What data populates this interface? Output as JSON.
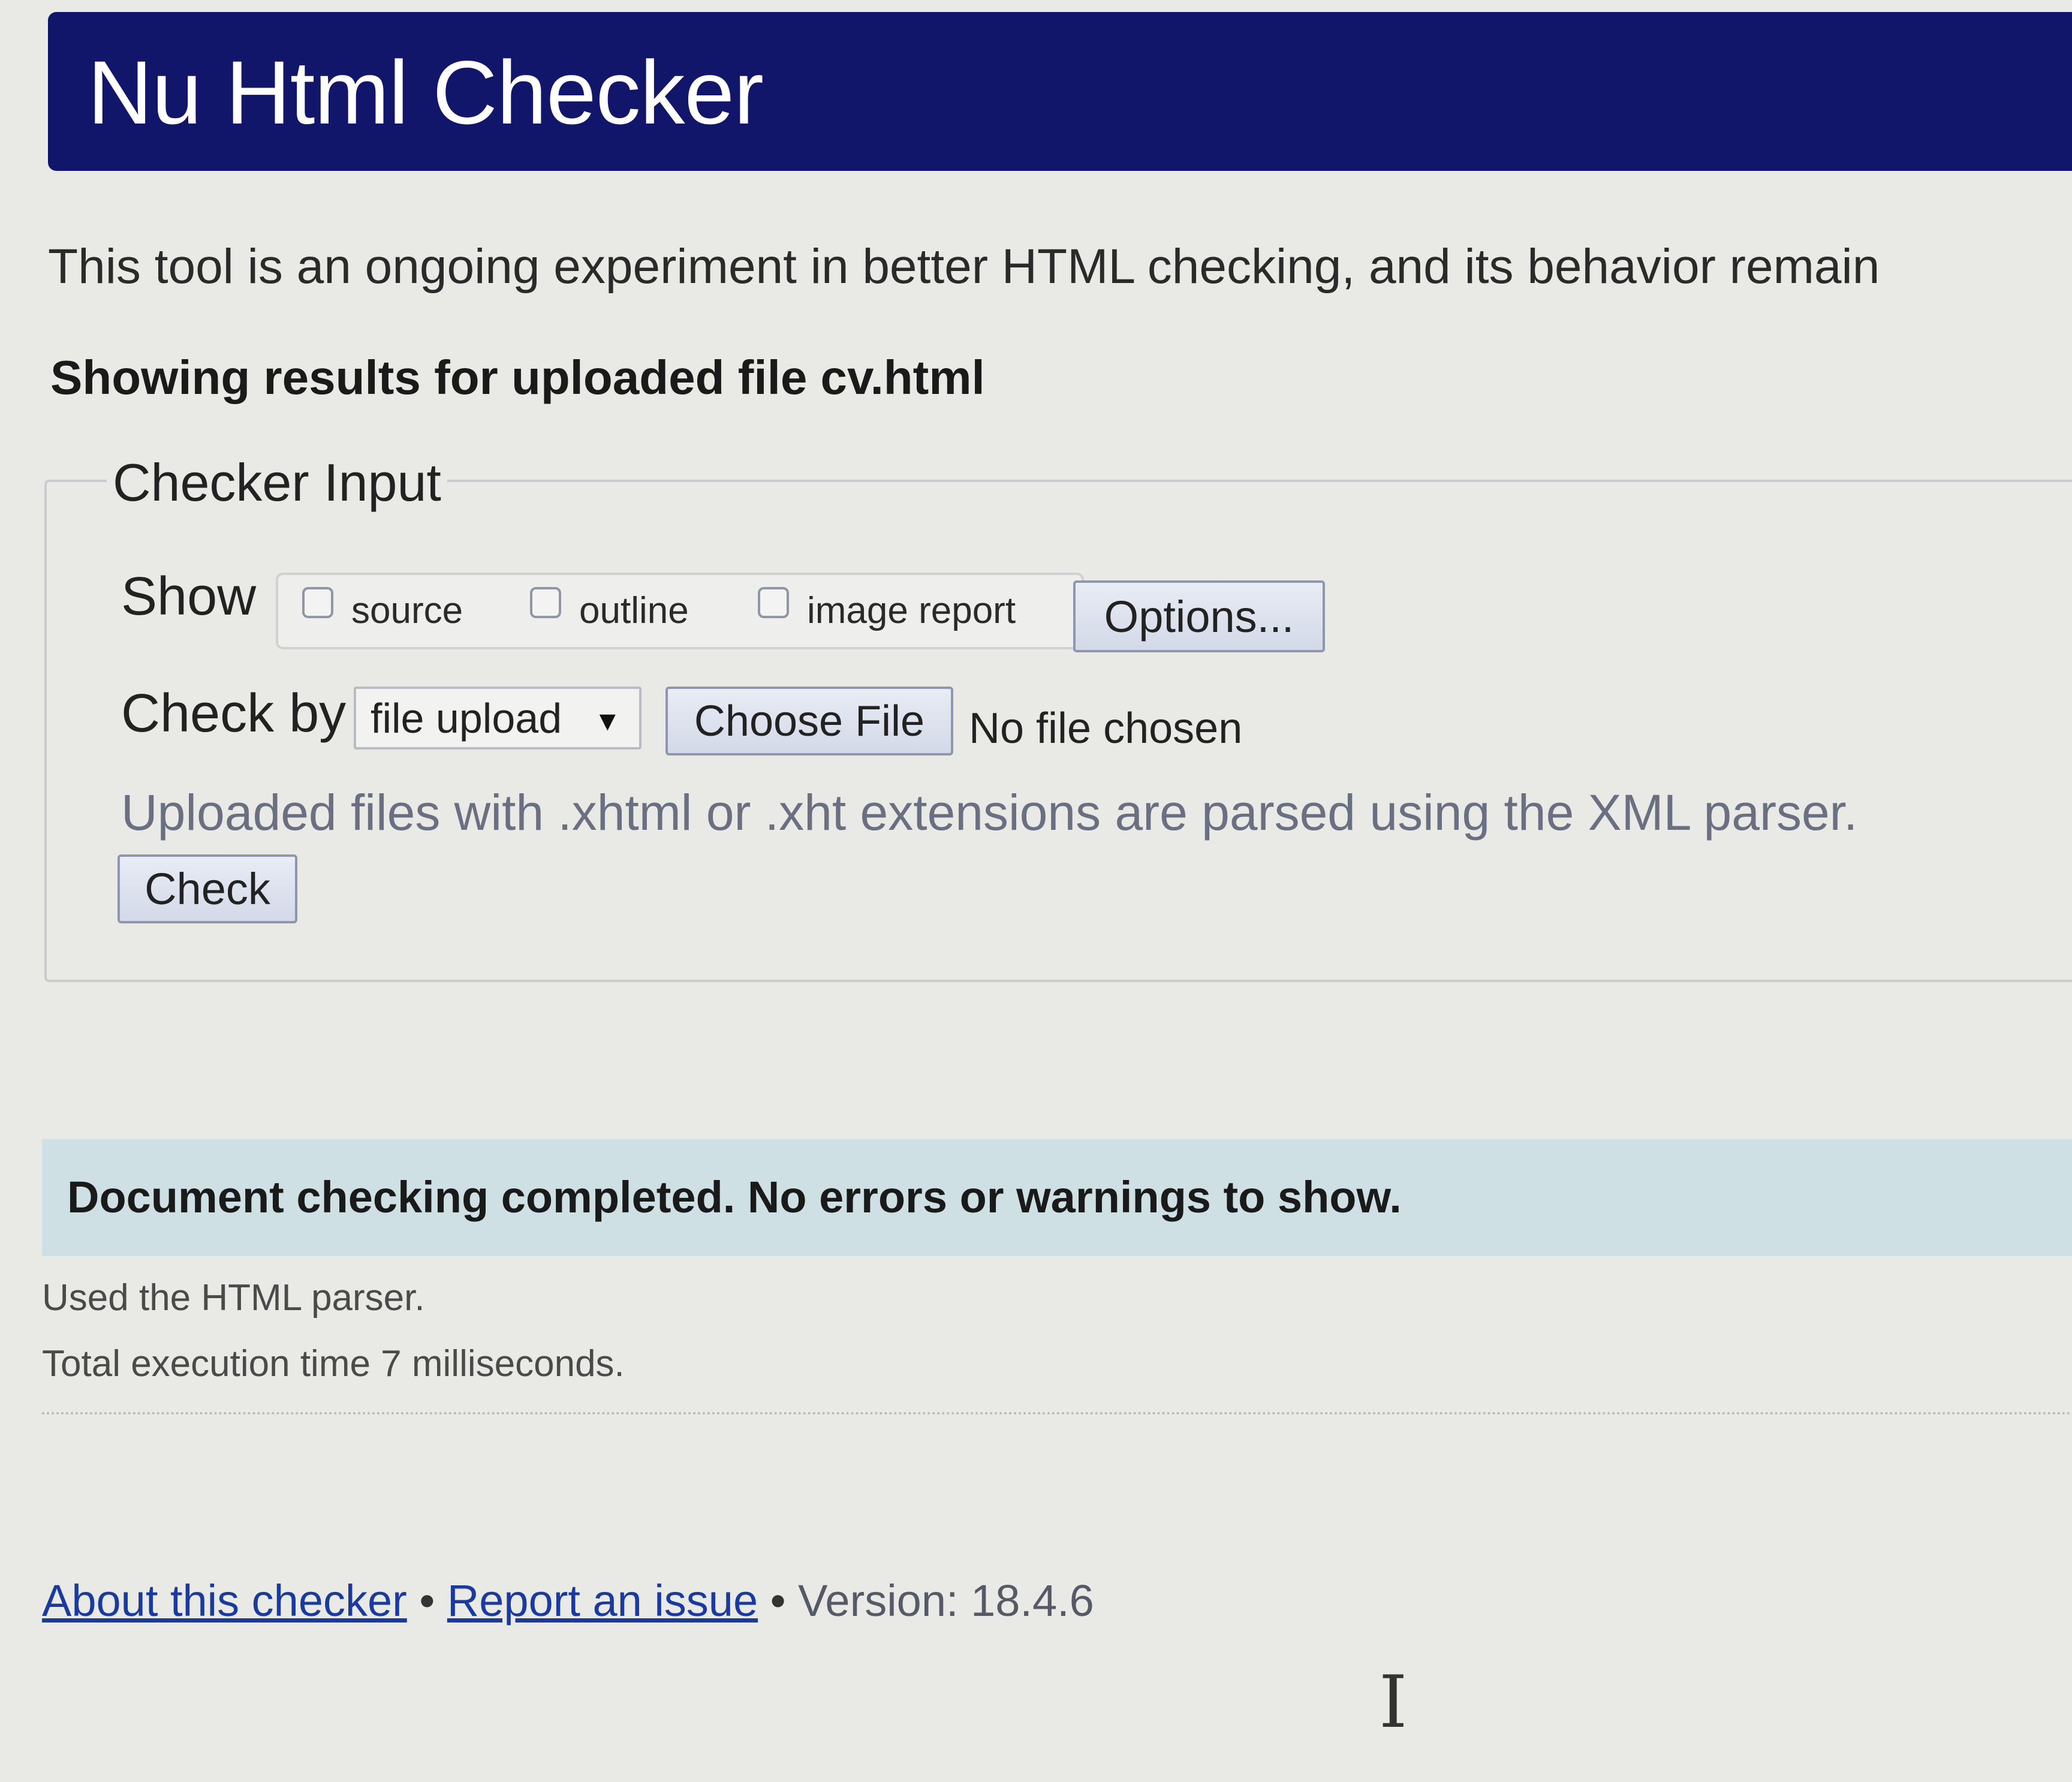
{
  "header": {
    "title": "Nu Html Checker"
  },
  "intro": {
    "text": "This tool is an ongoing experiment in better HTML checking, and its behavior remain"
  },
  "results": {
    "heading": "Showing results for uploaded file cv.html"
  },
  "checker_input": {
    "legend": "Checker Input",
    "show_label": "Show",
    "show_options": [
      {
        "label": "source",
        "checked": false
      },
      {
        "label": "outline",
        "checked": false
      },
      {
        "label": "image report",
        "checked": false
      }
    ],
    "options_button": "Options...",
    "check_by_label": "Check by",
    "check_by_value": "file upload",
    "choose_file_button": "Choose File",
    "no_file_text": "No file chosen",
    "hint": "Uploaded files with .xhtml or .xht extensions are parsed using the XML parser.",
    "check_button": "Check"
  },
  "status": {
    "message": "Document checking completed. No errors or warnings to show."
  },
  "info": {
    "parser": "Used the HTML parser.",
    "execution_time": "Total execution time 7 milliseconds."
  },
  "footer": {
    "about_link": "About this checker",
    "separator": "•",
    "report_link": "Report an issue",
    "version": "Version: 18.4.6"
  },
  "colors": {
    "banner": "#12166b",
    "status_bar": "#cfe0e5",
    "link": "#1a3aa0"
  }
}
